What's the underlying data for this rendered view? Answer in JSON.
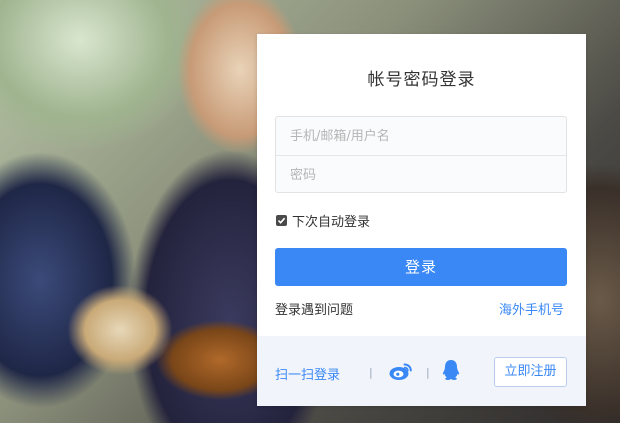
{
  "login": {
    "title": "帐号密码登录",
    "username_placeholder": "手机/邮箱/用户名",
    "password_placeholder": "密码",
    "remember_label": "下次自动登录",
    "remember_checked": true,
    "submit_label": "登录",
    "help_link": "登录遇到问题",
    "overseas_link": "海外手机号"
  },
  "footer": {
    "scan_link": "扫一扫登录",
    "separator": "|",
    "social_icons": [
      "weibo-icon",
      "qq-icon"
    ],
    "register_label": "立即注册"
  },
  "colors": {
    "accent": "#3a88f5",
    "footer_bg": "#f1f5fb",
    "panel_bg": "#ffffff"
  }
}
